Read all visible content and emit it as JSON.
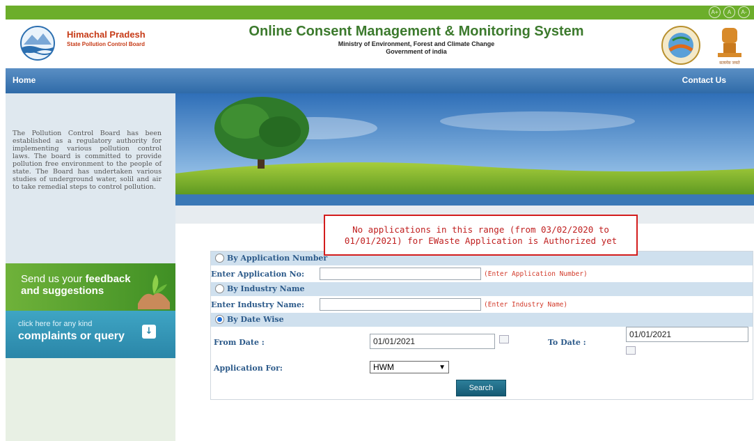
{
  "header": {
    "org_name": "Himachal Pradesh",
    "org_sub": "State Pollution Control Board",
    "title": "Online Consent Management & Monitoring System",
    "ministry": "Ministry of Environment, Forest and Climate Change",
    "government": "Government of india",
    "access_buttons": [
      "A+",
      "A",
      "A-"
    ],
    "emblem_text": "सत्यमेव जयते"
  },
  "nav": {
    "home": "Home",
    "contact": "Contact Us"
  },
  "sidebar": {
    "about": "The Pollution Control Board has been established as a regulatory authority for implementing various pollution control laws. The board is committed to provide pollution free environment to the people of state. The Board has undertaken various studies of underground water, solil and air to take remedial steps to control pollution.",
    "feedback_1": "Send us your ",
    "feedback_bold1": "feedback",
    "feedback_2": "and suggestions",
    "complaint_small": "click here for any kind",
    "complaint_big": "complaints or query"
  },
  "alert": {
    "line1": "No applications in this range (from 03/02/2020 to",
    "line2": "01/01/2021) for EWaste Application is Authorized yet"
  },
  "form": {
    "by_app": "By Application Number",
    "app_label": "Enter Application No:",
    "app_hint": "(Enter Application Number)",
    "by_industry": "By Industry Name",
    "industry_label": "Enter Industry Name:",
    "industry_hint": "(Enter Industry Name)",
    "by_date": "By Date Wise",
    "from_label": "From Date :",
    "from_value": "01/01/2021",
    "to_label": "To Date :",
    "to_value": "01/01/2021",
    "appfor_label": "Application For:",
    "appfor_value": "HWM",
    "search": "Search",
    "selected_mode": "By Date Wise"
  }
}
